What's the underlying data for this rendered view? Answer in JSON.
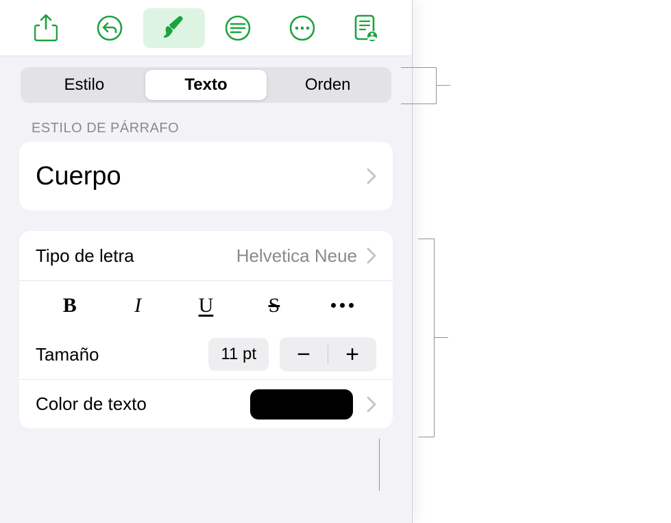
{
  "toolbar": {
    "icons": {
      "share": "share-icon",
      "undo": "undo-icon",
      "format": "paintbrush-icon",
      "text_options": "text-options-icon",
      "more": "ellipsis-circle-icon",
      "document": "document-reader-icon"
    }
  },
  "tabs": {
    "style": "Estilo",
    "text": "Texto",
    "order": "Orden",
    "selected": "text"
  },
  "paragraph_style": {
    "header": "ESTILO DE PÁRRAFO",
    "value": "Cuerpo"
  },
  "font": {
    "label": "Tipo de letra",
    "value": "Helvetica Neue"
  },
  "style_buttons": {
    "bold": "B",
    "italic": "I",
    "underline": "U",
    "strike": "S"
  },
  "size": {
    "label": "Tamaño",
    "value": "11 pt",
    "decrease": "−",
    "increase": "+"
  },
  "text_color": {
    "label": "Color de texto",
    "value": "#000000"
  }
}
